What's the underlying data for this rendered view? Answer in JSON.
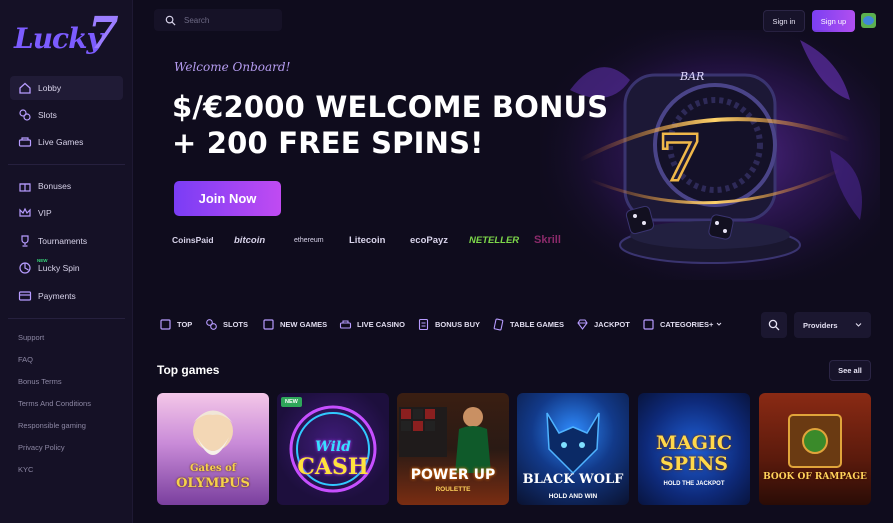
{
  "brand": {
    "logo_text": "Lucky",
    "logo_seven": "7"
  },
  "colors": {
    "accent": "#7b3ff2",
    "accent_end": "#c04bf2",
    "bg": "#0f0c1d",
    "sidebar": "#151126",
    "new_green": "#37d67a"
  },
  "sidebar": {
    "items": [
      {
        "label": "Lobby",
        "icon": "home-icon"
      },
      {
        "label": "Slots",
        "icon": "slots-icon"
      },
      {
        "label": "Live Games",
        "icon": "live-games-icon"
      },
      {
        "label": "Bonuses",
        "icon": "gift-icon"
      },
      {
        "label": "VIP",
        "icon": "crown-icon"
      },
      {
        "label": "Tournaments",
        "icon": "trophy-icon"
      },
      {
        "label": "Lucky Spin",
        "icon": "spin-icon",
        "badge": "NEW"
      },
      {
        "label": "Payments",
        "icon": "card-icon"
      }
    ],
    "links": [
      "Support",
      "FAQ",
      "Bonus Terms",
      "Terms And Conditions",
      "Responsible gaming",
      "Privacy Policy",
      "KYC"
    ]
  },
  "header": {
    "search_placeholder": "Search",
    "signin_label": "Sign in",
    "signup_label": "Sign up",
    "language_icon": "globe-flag-icon"
  },
  "hero": {
    "welcome": "Welcome Onboard!",
    "headline_line1": "$/€2000 WELCOME BONUS",
    "headline_line2": "+ 200 FREE SPINS!",
    "cta": "Join Now",
    "payments": [
      "CoinsPaid",
      "bitcoin",
      "ethereum",
      "Litecoin",
      "ecoPayz",
      "NETELLER",
      "Skrill"
    ]
  },
  "categories": [
    {
      "label": "TOP",
      "icon": "top-icon"
    },
    {
      "label": "SLOTS",
      "icon": "slots-icon"
    },
    {
      "label": "NEW GAMES",
      "icon": "new-games-icon"
    },
    {
      "label": "LIVE CASINO",
      "icon": "live-casino-icon"
    },
    {
      "label": "BONUS BUY",
      "icon": "bonus-buy-icon"
    },
    {
      "label": "TABLE GAMES",
      "icon": "table-games-icon"
    },
    {
      "label": "JACKPOT",
      "icon": "diamond-icon"
    },
    {
      "label": "CATEGORIES+",
      "icon": "categories-icon"
    }
  ],
  "providers_label": "Providers",
  "top_games": {
    "title": "Top games",
    "see_all": "See all",
    "games": [
      {
        "name": "Gates of Olympus",
        "title_lines": [
          "Gates of",
          "OLYMPUS"
        ],
        "sub": ""
      },
      {
        "name": "Wild Cash",
        "title_lines": [
          "Wild",
          "CASH"
        ],
        "sub": "",
        "badge": "NEW"
      },
      {
        "name": "Power Up Roulette",
        "title_lines": [
          "POWER UP"
        ],
        "sub": "ROULETTE"
      },
      {
        "name": "Black Wolf",
        "title_lines": [
          "BLACK WOLF"
        ],
        "sub": "HOLD AND WIN"
      },
      {
        "name": "Magic Spins",
        "title_lines": [
          "MAGIC",
          "SPINS"
        ],
        "sub": "HOLD THE JACKPOT"
      },
      {
        "name": "Book of Rampage",
        "title_lines": [
          "BOOK OF RAMPAGE"
        ],
        "sub": ""
      }
    ]
  }
}
